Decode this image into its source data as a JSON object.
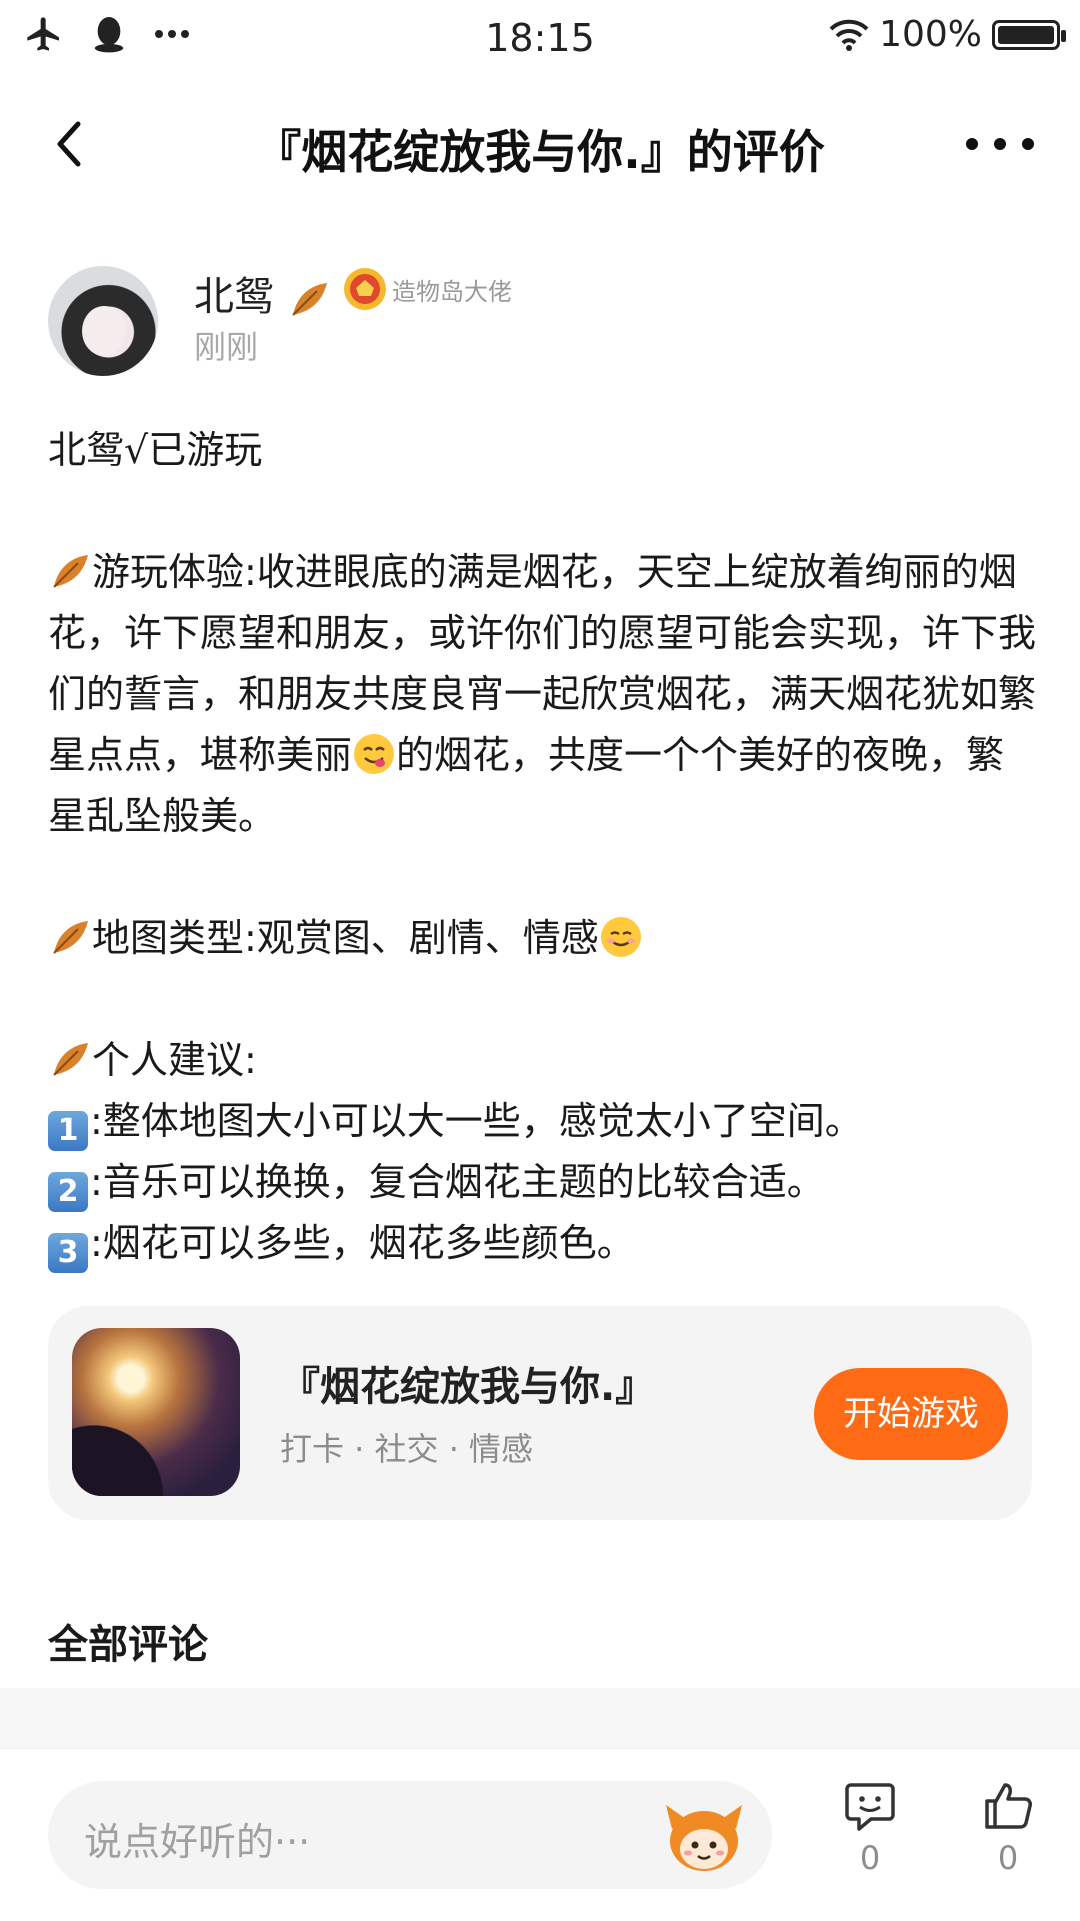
{
  "status_bar": {
    "time": "18:15",
    "battery": "100%",
    "battery_level": 1.0
  },
  "nav": {
    "title": "『烟花绽放我与你.』的评价"
  },
  "author": {
    "name": "北鸳",
    "badge": "造物岛大佬",
    "time": "刚刚"
  },
  "review": {
    "title_line": "北鸳√已游玩",
    "experience_a": "游玩体验:收进眼底的满是烟花，天空上绽放着绚丽的烟花，许下愿望和朋友，或许你们的愿望可能会实现，许下我们的誓言，和朋友共度良宵一起欣赏烟花，满天烟花犹如繁星点点，堪称美丽",
    "experience_b": "的烟花，共度一个个美好的夜晚，繁星乱坠般美。",
    "map_type": "地图类型:观赏图、剧情、情感",
    "advice_heading": "个人建议:",
    "advice": [
      {
        "num": "1",
        "text": ":整体地图大小可以大一些，感觉太小了空间。"
      },
      {
        "num": "2",
        "text": ":音乐可以换换，复合烟花主题的比较合适。"
      },
      {
        "num": "3",
        "text": ":烟花可以多些，烟花多些颜色。"
      }
    ]
  },
  "game_card": {
    "title": "『烟花绽放我与你.』",
    "tags": "打卡 · 社交 · 情感",
    "play_label": "开始游戏"
  },
  "comments": {
    "title": "全部评论"
  },
  "bottom_bar": {
    "input_placeholder": "说点好听的···",
    "comment_count": "0",
    "like_count": "0"
  },
  "colors": {
    "accent": "#ff6a14",
    "leaf": "#d9822b"
  }
}
